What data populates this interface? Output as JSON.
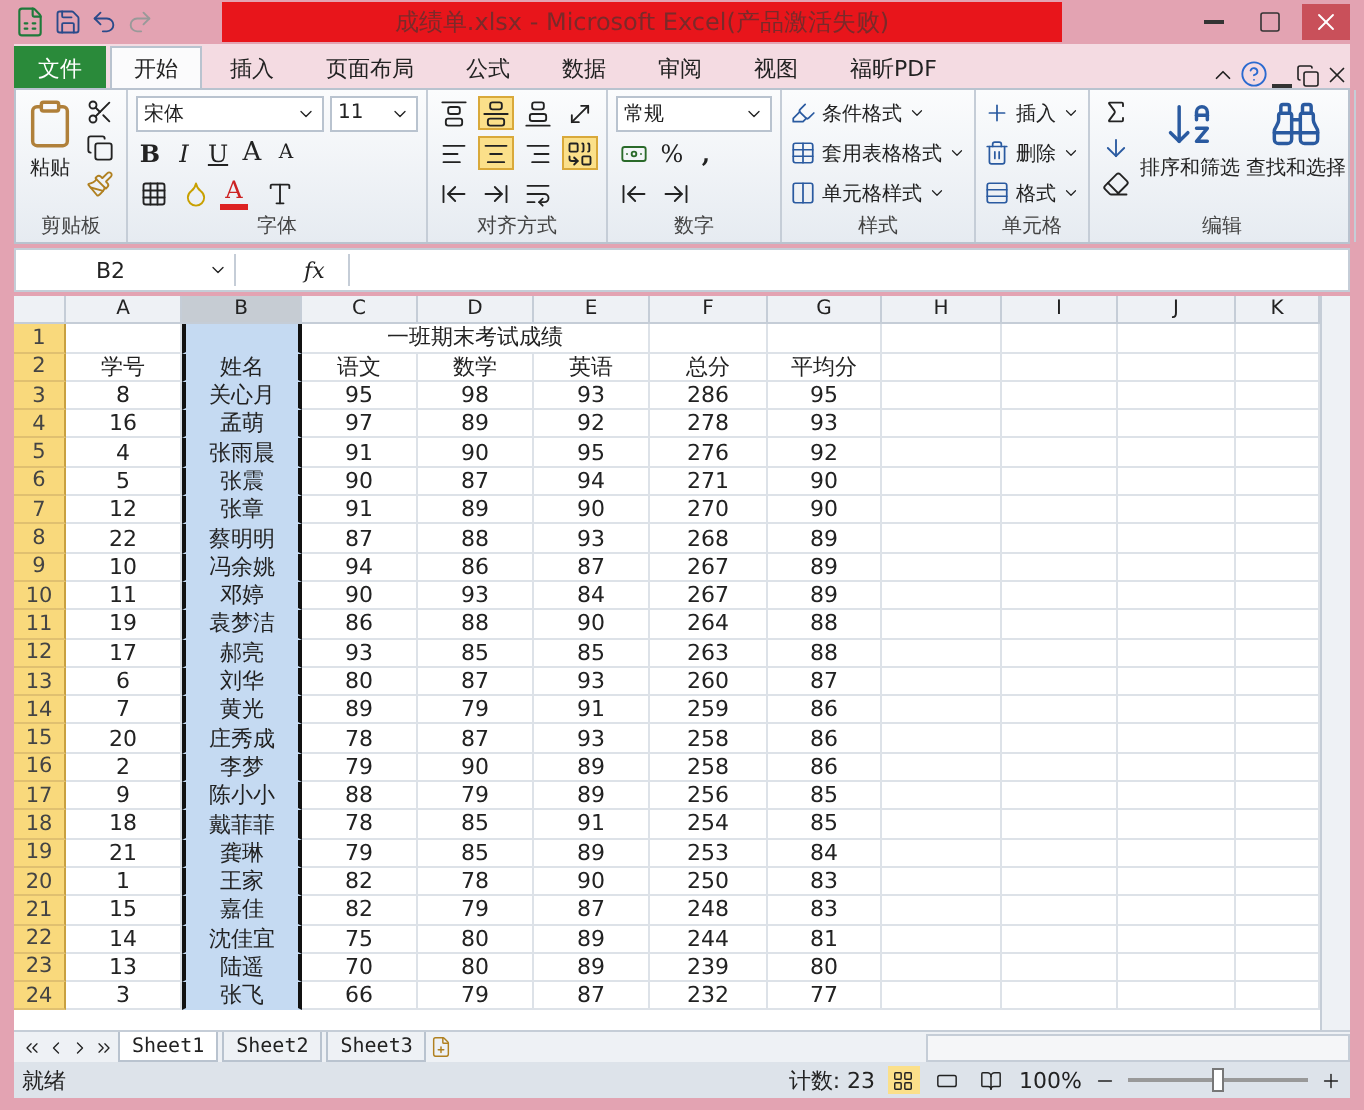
{
  "window": {
    "title": "成绩单.xlsx - Microsoft Excel(产品激活失败)"
  },
  "ribbon_tabs": [
    {
      "label": "文件",
      "kind": "file",
      "selected": false
    },
    {
      "label": "开始",
      "kind": "tab",
      "selected": true
    },
    {
      "label": "插入",
      "kind": "tab",
      "selected": false
    },
    {
      "label": "页面布局",
      "kind": "tab",
      "selected": false
    },
    {
      "label": "公式",
      "kind": "tab",
      "selected": false
    },
    {
      "label": "数据",
      "kind": "tab",
      "selected": false
    },
    {
      "label": "审阅",
      "kind": "tab",
      "selected": false
    },
    {
      "label": "视图",
      "kind": "tab",
      "selected": false
    },
    {
      "label": "福昕PDF",
      "kind": "tab",
      "selected": false
    }
  ],
  "clipboard": {
    "paste": "粘贴",
    "label": "剪贴板"
  },
  "font": {
    "name": "宋体",
    "size": "11",
    "styles": [
      "B",
      "I",
      "U"
    ],
    "grow": "A",
    "shrink": "A",
    "color_glyph": "A",
    "label": "字体"
  },
  "alignment": {
    "buttons": [
      {
        "kind": "top",
        "on": false
      },
      {
        "kind": "middle",
        "on": true
      },
      {
        "kind": "bottom",
        "on": false
      },
      {
        "kind": "orient",
        "on": false
      },
      {
        "kind": "left",
        "on": false
      },
      {
        "kind": "center",
        "on": true
      },
      {
        "kind": "right",
        "on": false
      },
      {
        "kind": "merge",
        "on": true
      },
      {
        "kind": "outdent",
        "on": false
      },
      {
        "kind": "indent",
        "on": false
      },
      {
        "kind": "wrap",
        "on": false
      }
    ],
    "label": "对齐方式"
  },
  "number": {
    "format": "常规",
    "percent": "%",
    "comma": ",",
    "label": "数字"
  },
  "styles": {
    "items": [
      "条件格式",
      "套用表格格式",
      "单元格样式"
    ],
    "label": "样式"
  },
  "cells": {
    "items": [
      "插入",
      "删除",
      "格式"
    ],
    "label": "单元格"
  },
  "editing": {
    "sort": "排序和筛选",
    "find": "查找和选择",
    "label": "编辑"
  },
  "formula_bar": {
    "name_box": "B2",
    "fx": "fx"
  },
  "sheet": {
    "columns": [
      {
        "label": "A",
        "selected": false
      },
      {
        "label": "B",
        "selected": true
      },
      {
        "label": "C",
        "selected": false
      },
      {
        "label": "D",
        "selected": false
      },
      {
        "label": "E",
        "selected": false
      },
      {
        "label": "F",
        "selected": false
      },
      {
        "label": "G",
        "selected": false
      },
      {
        "label": "H",
        "selected": false
      },
      {
        "label": "I",
        "selected": false
      },
      {
        "label": "J",
        "selected": false
      },
      {
        "label": "K",
        "selected": false
      }
    ],
    "title": "一班期末考试成绩",
    "rows": [
      {
        "number": "1",
        "cells": []
      },
      {
        "number": "2",
        "cells": [
          "学号",
          "姓名",
          "语文",
          "数学",
          "英语",
          "总分",
          "平均分"
        ]
      },
      {
        "number": "3",
        "cells": [
          "8",
          "关心月",
          "95",
          "98",
          "93",
          "286",
          "95"
        ]
      },
      {
        "number": "4",
        "cells": [
          "16",
          "孟萌",
          "97",
          "89",
          "92",
          "278",
          "93"
        ]
      },
      {
        "number": "5",
        "cells": [
          "4",
          "张雨晨",
          "91",
          "90",
          "95",
          "276",
          "92"
        ]
      },
      {
        "number": "6",
        "cells": [
          "5",
          "张震",
          "90",
          "87",
          "94",
          "271",
          "90"
        ]
      },
      {
        "number": "7",
        "cells": [
          "12",
          "张章",
          "91",
          "89",
          "90",
          "270",
          "90"
        ]
      },
      {
        "number": "8",
        "cells": [
          "22",
          "蔡明明",
          "87",
          "88",
          "93",
          "268",
          "89"
        ]
      },
      {
        "number": "9",
        "cells": [
          "10",
          "冯余姚",
          "94",
          "86",
          "87",
          "267",
          "89"
        ]
      },
      {
        "number": "10",
        "cells": [
          "11",
          "邓婷",
          "90",
          "93",
          "84",
          "267",
          "89"
        ]
      },
      {
        "number": "11",
        "cells": [
          "19",
          "袁梦洁",
          "86",
          "88",
          "90",
          "264",
          "88"
        ]
      },
      {
        "number": "12",
        "cells": [
          "17",
          "郝亮",
          "93",
          "85",
          "85",
          "263",
          "88"
        ]
      },
      {
        "number": "13",
        "cells": [
          "6",
          "刘华",
          "80",
          "87",
          "93",
          "260",
          "87"
        ]
      },
      {
        "number": "14",
        "cells": [
          "7",
          "黄光",
          "89",
          "79",
          "91",
          "259",
          "86"
        ]
      },
      {
        "number": "15",
        "cells": [
          "20",
          "庄秀成",
          "78",
          "87",
          "93",
          "258",
          "86"
        ]
      },
      {
        "number": "16",
        "cells": [
          "2",
          "李梦",
          "79",
          "90",
          "89",
          "258",
          "86"
        ]
      },
      {
        "number": "17",
        "cells": [
          "9",
          "陈小小",
          "88",
          "79",
          "89",
          "256",
          "85"
        ]
      },
      {
        "number": "18",
        "cells": [
          "18",
          "戴菲菲",
          "78",
          "85",
          "91",
          "254",
          "85"
        ]
      },
      {
        "number": "19",
        "cells": [
          "21",
          "龚琳",
          "79",
          "85",
          "89",
          "253",
          "84"
        ]
      },
      {
        "number": "20",
        "cells": [
          "1",
          "王家",
          "82",
          "78",
          "90",
          "250",
          "83"
        ]
      },
      {
        "number": "21",
        "cells": [
          "15",
          "嘉佳",
          "82",
          "79",
          "87",
          "248",
          "83"
        ]
      },
      {
        "number": "22",
        "cells": [
          "14",
          "沈佳宜",
          "75",
          "80",
          "89",
          "244",
          "81"
        ]
      },
      {
        "number": "23",
        "cells": [
          "13",
          "陆遥",
          "70",
          "80",
          "89",
          "239",
          "80"
        ]
      },
      {
        "number": "24",
        "cells": [
          "3",
          "张飞",
          "66",
          "79",
          "87",
          "232",
          "77"
        ]
      }
    ]
  },
  "sheet_tabs": [
    {
      "label": "Sheet1",
      "selected": true
    },
    {
      "label": "Sheet2",
      "selected": false
    },
    {
      "label": "Sheet3",
      "selected": false
    }
  ],
  "status_bar": {
    "mode": "就绪",
    "count": "计数: 23",
    "views": [
      {
        "kind": "normal",
        "selected": true
      },
      {
        "kind": "layout",
        "selected": false
      },
      {
        "kind": "break",
        "selected": false
      }
    ],
    "zoom": "100%",
    "zoom_slider": {
      "level": 0.5
    }
  }
}
